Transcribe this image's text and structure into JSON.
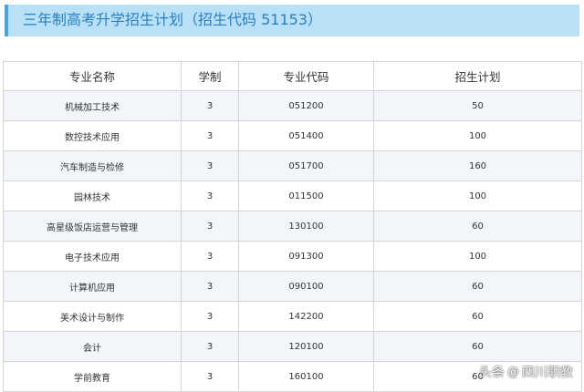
{
  "title": "三年制高考升学招生计划（招生代码 51153）",
  "table": {
    "headers": [
      "专业名称",
      "学制",
      "专业代码",
      "招生计划"
    ],
    "rows": [
      {
        "name": "机械加工技术",
        "years": "3",
        "code": "051200",
        "plan": "50"
      },
      {
        "name": "数控技术应用",
        "years": "3",
        "code": "051400",
        "plan": "100"
      },
      {
        "name": "汽车制造与检修",
        "years": "3",
        "code": "051700",
        "plan": "160"
      },
      {
        "name": "园林技术",
        "years": "3",
        "code": "011500",
        "plan": "100"
      },
      {
        "name": "高星级饭店运营与管理",
        "years": "3",
        "code": "130100",
        "plan": "60"
      },
      {
        "name": "电子技术应用",
        "years": "3",
        "code": "091300",
        "plan": "100"
      },
      {
        "name": "计算机应用",
        "years": "3",
        "code": "090100",
        "plan": "60"
      },
      {
        "name": "美术设计与制作",
        "years": "3",
        "code": "142200",
        "plan": "60"
      },
      {
        "name": "会计",
        "years": "3",
        "code": "120100",
        "plan": "60"
      },
      {
        "name": "学前教育",
        "years": "3",
        "code": "160100",
        "plan": "60"
      }
    ]
  },
  "watermark": {
    "prefix": "头条",
    "at": "@",
    "account": "四川职教"
  },
  "colors": {
    "title_bg": "#b8e0f7",
    "title_accent": "#4aa3df",
    "title_text": "#2a7fc0",
    "row_alt": "#f2f6fa",
    "border": "#d4d4d4"
  }
}
